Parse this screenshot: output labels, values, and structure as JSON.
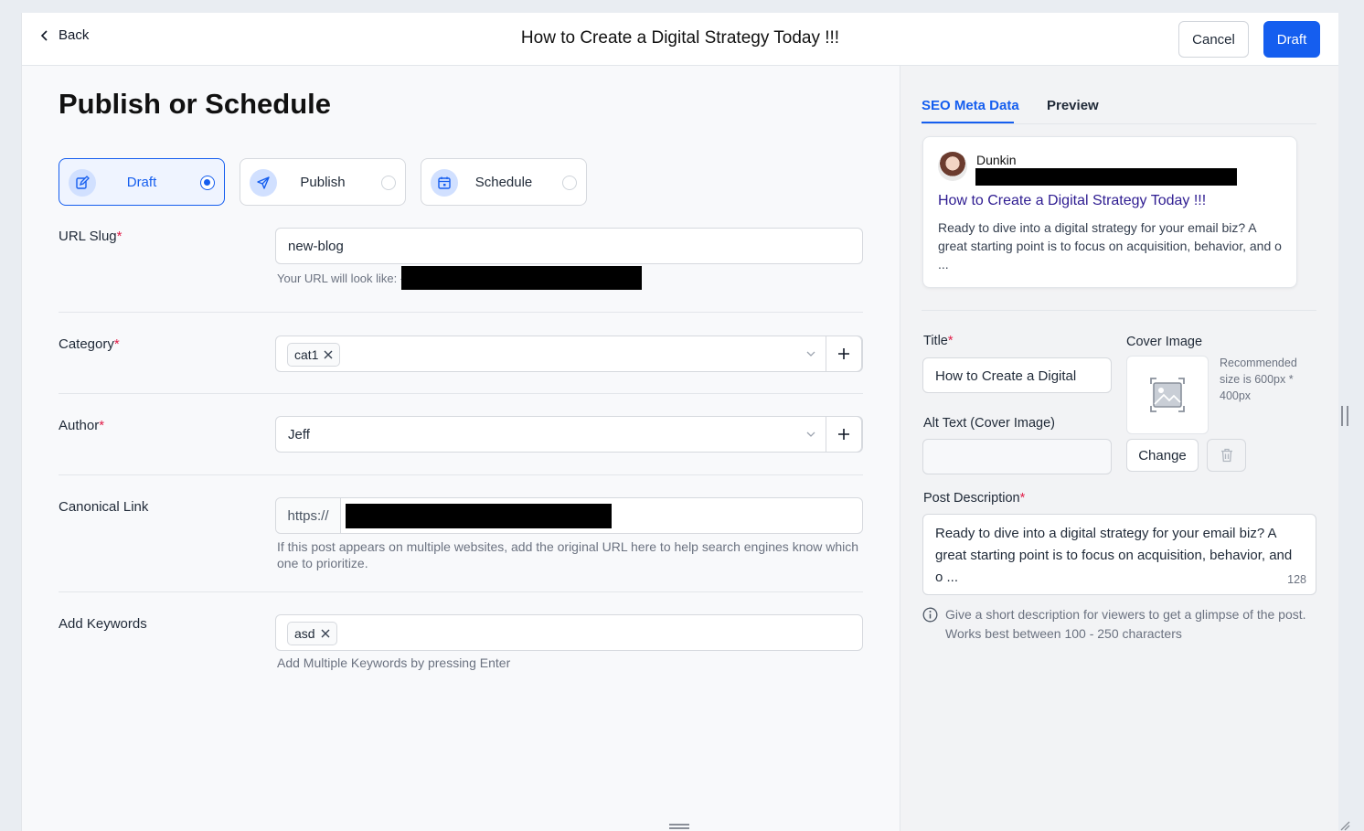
{
  "header": {
    "back_label": "Back",
    "title": "How to Create a Digital Strategy Today !!!",
    "cancel_label": "Cancel",
    "draft_label": "Draft"
  },
  "main": {
    "section_title": "Publish or Schedule",
    "options": [
      {
        "label": "Draft",
        "selected": true,
        "icon": "edit-icon"
      },
      {
        "label": "Publish",
        "selected": false,
        "icon": "send-icon"
      },
      {
        "label": "Schedule",
        "selected": false,
        "icon": "calendar-icon"
      }
    ],
    "url_slug": {
      "label": "URL Slug",
      "required_mark": "*",
      "value": "new-blog",
      "hint": "Your URL will look like: -"
    },
    "category": {
      "label": "Category",
      "required_mark": "*",
      "tags": [
        "cat1"
      ]
    },
    "author": {
      "label": "Author",
      "required_mark": "*",
      "value": "Jeff"
    },
    "canonical": {
      "label": "Canonical Link",
      "prefix": "https://",
      "hint": "If this post appears on multiple websites, add the original URL here to help search engines know which one to prioritize."
    },
    "keywords": {
      "label": "Add Keywords",
      "tags": [
        "asd"
      ],
      "hint": "Add Multiple Keywords by pressing Enter"
    }
  },
  "sidebar": {
    "tabs": [
      {
        "label": "SEO Meta Data",
        "active": true
      },
      {
        "label": "Preview",
        "active": false
      }
    ],
    "preview_card": {
      "author": "Dunkin",
      "title": "How to Create a Digital Strategy Today !!!",
      "description": "Ready to dive into a digital strategy for your email biz? A great starting point is to focus on acquisition, behavior, and o ..."
    },
    "title_field": {
      "label": "Title",
      "required_mark": "*",
      "value": "How to Create a Digital"
    },
    "cover_image": {
      "label": "Cover Image",
      "hint": "Recommended size is 600px * 400px",
      "change_label": "Change"
    },
    "alt_text": {
      "label": "Alt Text (Cover Image)",
      "value": ""
    },
    "post_description": {
      "label": "Post Description",
      "required_mark": "*",
      "value": "Ready to dive into a digital strategy for your email biz? A great starting point is to focus on acquisition, behavior, and o ...",
      "count": "128",
      "info": "Give a short description for viewers to get a glimpse of the post. Works best between 100 - 250 characters"
    }
  },
  "colors": {
    "accent": "#155eef",
    "required": "#e11d48",
    "card_title": "#2e1c91"
  }
}
